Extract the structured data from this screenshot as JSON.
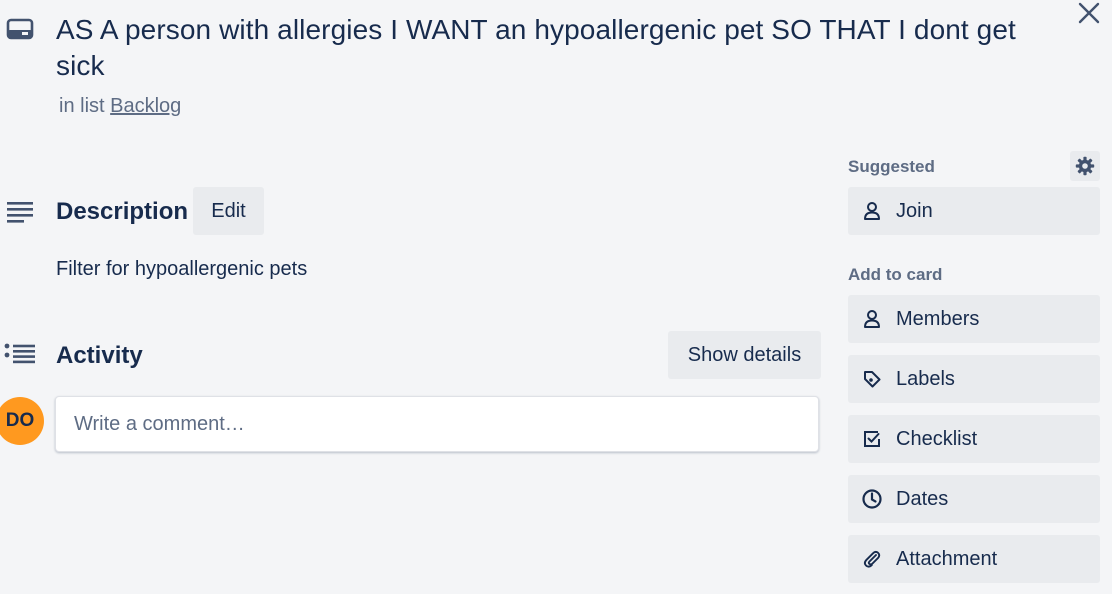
{
  "card": {
    "title": "AS A person with allergies I WANT an hypoallergenic pet SO THAT I dont get sick",
    "in_list_prefix": "in list",
    "list_name": "Backlog"
  },
  "description": {
    "heading": "Description",
    "edit_label": "Edit",
    "text": "Filter for hypoallergenic pets"
  },
  "activity": {
    "heading": "Activity",
    "show_details_label": "Show details",
    "avatar_initials": "DO",
    "comment_placeholder": "Write a comment…"
  },
  "sidebar": {
    "suggested_heading": "Suggested",
    "join_label": "Join",
    "add_to_card_heading": "Add to card",
    "buttons": [
      {
        "label": "Members",
        "icon": "person-icon"
      },
      {
        "label": "Labels",
        "icon": "label-tag-icon"
      },
      {
        "label": "Checklist",
        "icon": "checkbox-icon"
      },
      {
        "label": "Dates",
        "icon": "clock-icon"
      },
      {
        "label": "Attachment",
        "icon": "paperclip-icon"
      }
    ]
  },
  "colors": {
    "background": "#f4f5f7",
    "button_bg": "#e9ebee",
    "text_primary": "#172b4d",
    "text_secondary": "#5e6c84",
    "avatar_bg": "#ff991f"
  }
}
